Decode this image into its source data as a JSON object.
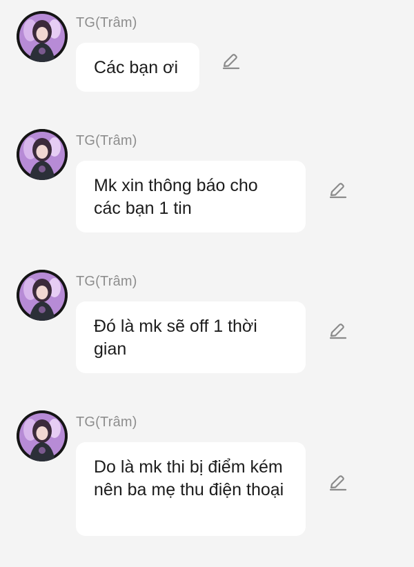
{
  "messages": [
    {
      "sender": "TG(Trâm)",
      "text": "Các bạn ơi"
    },
    {
      "sender": "TG(Trâm)",
      "text": "Mk xin thông báo cho các bạn 1 tin"
    },
    {
      "sender": "TG(Trâm)",
      "text": "Đó là mk sẽ off 1 thời gian"
    },
    {
      "sender": "TG(Trâm)",
      "text": "Do là mk thi bị điểm kém nên ba mẹ thu điện thoại"
    }
  ],
  "icons": {
    "edit": "pencil-icon",
    "avatar": "anime-girl-avatar"
  },
  "colors": {
    "background": "#f4f4f4",
    "bubble": "#ffffff",
    "sender": "#8d8d8d",
    "text": "#1c1c1c",
    "icon": "#8a8a8a"
  }
}
